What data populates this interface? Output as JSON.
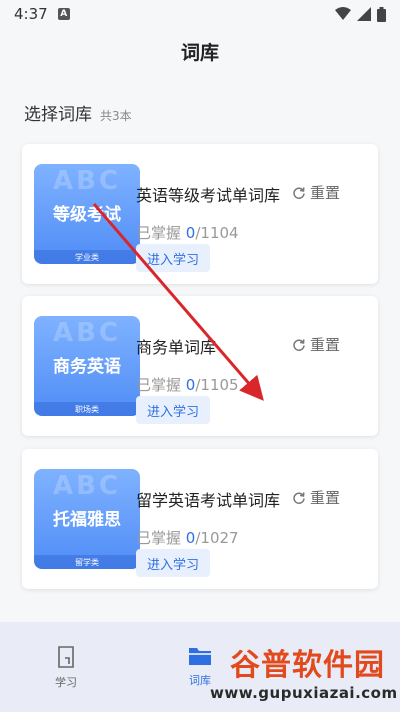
{
  "status_bar": {
    "time": "4:37",
    "notification": "A"
  },
  "header": {
    "title": "词库"
  },
  "section": {
    "title": "选择词库",
    "count": "共3本"
  },
  "books": [
    {
      "cover_text": "ABC",
      "cover_name": "等级考试",
      "category": "学业类",
      "title": "英语等级考试单词库",
      "reset_label": "重置",
      "progress_label": "已掌握",
      "progress_value": "0",
      "progress_total": "/1104",
      "study_label": "进入学习"
    },
    {
      "cover_text": "ABC",
      "cover_name": "商务英语",
      "category": "职场类",
      "title": "商务单词库",
      "reset_label": "重置",
      "progress_label": "已掌握",
      "progress_value": "0",
      "progress_total": "/1105",
      "study_label": "进入学习"
    },
    {
      "cover_text": "ABC",
      "cover_name": "托福雅思",
      "category": "留学类",
      "title": "留学英语考试单词库",
      "reset_label": "重置",
      "progress_label": "已掌握",
      "progress_value": "0",
      "progress_total": "/1027",
      "study_label": "进入学习"
    }
  ],
  "tabs": [
    {
      "label": "学习",
      "icon": "doc-icon",
      "active": false
    },
    {
      "label": "词库",
      "icon": "folder-icon",
      "active": true
    }
  ],
  "watermark": {
    "logo": "谷普软件园",
    "url": "www.gupuxiazai.com"
  },
  "colors": {
    "accent": "#2f6fe4",
    "arrow": "#d9262b",
    "cover_top": "#7fb2ff",
    "cover_bottom": "#4f8cf6"
  }
}
